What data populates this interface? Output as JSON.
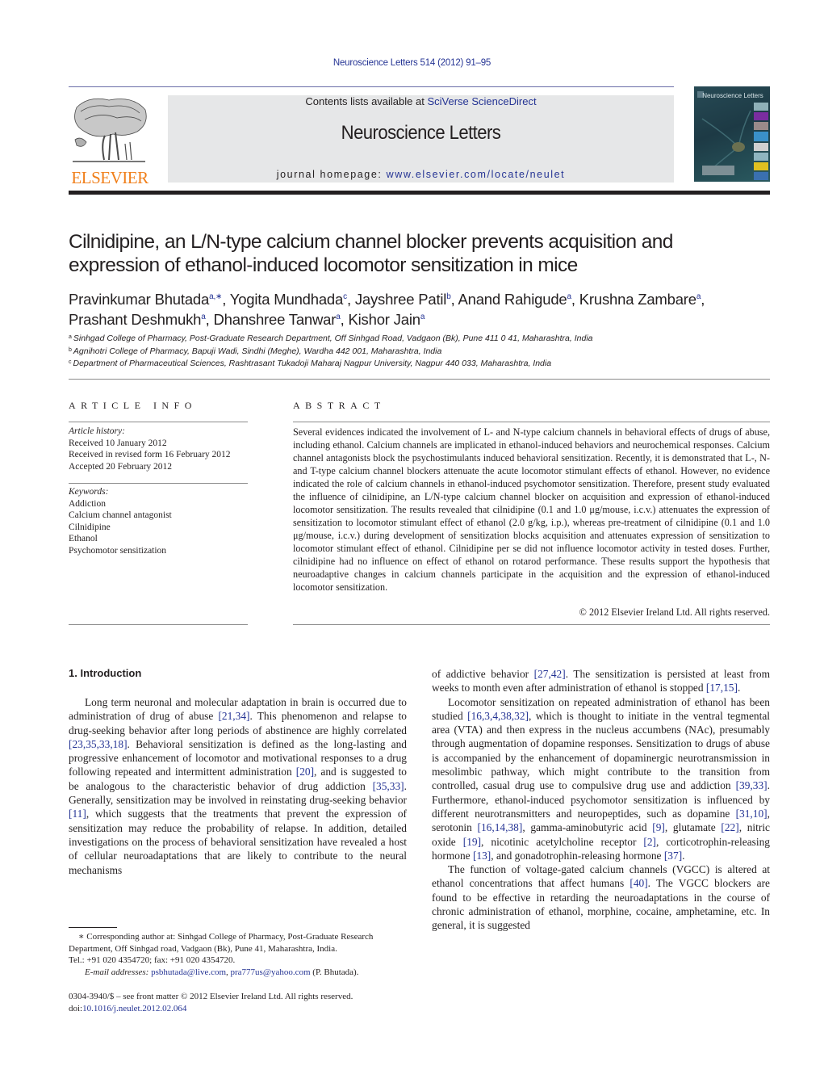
{
  "header": {
    "journal_ref": "Neuroscience Letters 514 (2012) 91–95",
    "contents_prefix": "Contents lists available at ",
    "contents_link": "SciVerse ScienceDirect",
    "journal_title": "Neuroscience Letters",
    "homepage_prefix": "journal homepage: ",
    "homepage_link": "www.elsevier.com/locate/neulet",
    "publisher_logo_text": "ELSEVIER",
    "cover_title": "Neuroscience Letters",
    "colors": {
      "link": "#253494",
      "elsevier_orange": "#f07f1a",
      "banner_bg": "#e6e7e8"
    }
  },
  "article": {
    "title": "Cilnidipine, an L/N-type calcium channel blocker prevents acquisition and expression of ethanol-induced locomotor sensitization in mice",
    "authors": [
      {
        "name": "Pravinkumar Bhutada",
        "sup": "a,∗"
      },
      {
        "name": "Yogita Mundhada",
        "sup": "c"
      },
      {
        "name": "Jayshree Patil",
        "sup": "b"
      },
      {
        "name": "Anand Rahigude",
        "sup": "a"
      },
      {
        "name": "Krushna Zambare",
        "sup": "a"
      },
      {
        "name": "Prashant Deshmukh",
        "sup": "a"
      },
      {
        "name": "Dhanshree Tanwar",
        "sup": "a"
      },
      {
        "name": "Kishor Jain",
        "sup": "a"
      }
    ],
    "affiliations": [
      {
        "key": "a",
        "text": "Sinhgad College of Pharmacy, Post-Graduate Research Department, Off Sinhgad Road, Vadgaon (Bk), Pune 411 0 41, Maharashtra, India"
      },
      {
        "key": "b",
        "text": "Agnihotri College of Pharmacy, Bapuji Wadi, Sindhi (Meghe), Wardha 442 001, Maharashtra, India"
      },
      {
        "key": "c",
        "text": "Department of Pharmaceutical Sciences, Rashtrasant Tukadoji Maharaj Nagpur University, Nagpur 440 033, Maharashtra, India"
      }
    ]
  },
  "article_info": {
    "heading": "ARTICLE INFO",
    "history_label": "Article history:",
    "history": [
      "Received 10 January 2012",
      "Received in revised form 16 February 2012",
      "Accepted 20 February 2012"
    ],
    "keywords_label": "Keywords:",
    "keywords": [
      "Addiction",
      "Calcium channel antagonist",
      "Cilnidipine",
      "Ethanol",
      "Psychomotor sensitization"
    ]
  },
  "abstract": {
    "heading": "ABSTRACT",
    "text": "Several evidences indicated the involvement of L- and N-type calcium channels in behavioral effects of drugs of abuse, including ethanol. Calcium channels are implicated in ethanol-induced behaviors and neurochemical responses. Calcium channel antagonists block the psychostimulants induced behavioral sensitization. Recently, it is demonstrated that L-, N- and T-type calcium channel blockers attenuate the acute locomotor stimulant effects of ethanol. However, no evidence indicated the role of calcium channels in ethanol-induced psychomotor sensitization. Therefore, present study evaluated the influence of cilnidipine, an L/N-type calcium channel blocker on acquisition and expression of ethanol-induced locomotor sensitization. The results revealed that cilnidipine (0.1 and 1.0 μg/mouse, i.c.v.) attenuates the expression of sensitization to locomotor stimulant effect of ethanol (2.0 g/kg, i.p.), whereas pre-treatment of cilnidipine (0.1 and 1.0 μg/mouse, i.c.v.) during development of sensitization blocks acquisition and attenuates expression of sensitization to locomotor stimulant effect of ethanol. Cilnidipine per se did not influence locomotor activity in tested doses. Further, cilnidipine had no influence on effect of ethanol on rotarod performance. These results support the hypothesis that neuroadaptive changes in calcium channels participate in the acquisition and the expression of ethanol-induced locomotor sensitization.",
    "copyright": "© 2012 Elsevier Ireland Ltd. All rights reserved."
  },
  "body": {
    "section_heading": "1.  Introduction",
    "left_paragraph": [
      {
        "t": "Long term neuronal and molecular adaptation in brain is occurred due to administration of drug of abuse "
      },
      {
        "ref": "[21,34]"
      },
      {
        "t": ". This phenomenon and relapse to drug-seeking behavior after long periods of abstinence are highly correlated "
      },
      {
        "ref": "[23,35,33,18]"
      },
      {
        "t": ". Behavioral sensitization is defined as the long-lasting and progressive enhancement of locomotor and motivational responses to a drug following repeated and intermittent administration "
      },
      {
        "ref": "[20]"
      },
      {
        "t": ", and is suggested to be analogous to the characteristic behavior of drug addiction "
      },
      {
        "ref": "[35,33]"
      },
      {
        "t": ". Generally, sensitization may be involved in reinstating drug-seeking behavior "
      },
      {
        "ref": "[11]"
      },
      {
        "t": ", which suggests that the treatments that prevent the expression of sensitization may reduce the probability of relapse. In addition, detailed investigations on the process of behavioral sensitization have revealed a host of cellular neuroadaptations that are likely to contribute to the neural mechanisms"
      }
    ],
    "right_paragraphs": [
      [
        {
          "t": "of addictive behavior "
        },
        {
          "ref": "[27,42]"
        },
        {
          "t": ". The sensitization is persisted at least from weeks to month even after administration of ethanol is stopped "
        },
        {
          "ref": "[17,15]"
        },
        {
          "t": "."
        }
      ],
      [
        {
          "t": "Locomotor sensitization on repeated administration of ethanol has been studied "
        },
        {
          "ref": "[16,3,4,38,32]"
        },
        {
          "t": ", which is thought to initiate in the ventral tegmental area (VTA) and then express in the nucleus accumbens (NAc), presumably through augmentation of dopamine responses. Sensitization to drugs of abuse is accompanied by the enhancement of dopaminergic neurotransmission in mesolimbic pathway, which might contribute to the transition from controlled, casual drug use to compulsive drug use and addiction "
        },
        {
          "ref": "[39,33]"
        },
        {
          "t": ". Furthermore, ethanol-induced psychomotor sensitization is influenced by different neurotransmitters and neuropeptides, such as dopamine "
        },
        {
          "ref": "[31,10]"
        },
        {
          "t": ", serotonin "
        },
        {
          "ref": "[16,14,38]"
        },
        {
          "t": ", gamma-aminobutyric acid "
        },
        {
          "ref": "[9]"
        },
        {
          "t": ", glutamate "
        },
        {
          "ref": "[22]"
        },
        {
          "t": ", nitric oxide "
        },
        {
          "ref": "[19]"
        },
        {
          "t": ", nicotinic acetylcholine receptor "
        },
        {
          "ref": "[2]"
        },
        {
          "t": ", corticotrophin-releasing hormone "
        },
        {
          "ref": "[13]"
        },
        {
          "t": ", and gonadotrophin-releasing hormone "
        },
        {
          "ref": "[37]"
        },
        {
          "t": "."
        }
      ],
      [
        {
          "t": "The function of voltage-gated calcium channels (VGCC) is altered at ethanol concentrations that affect humans "
        },
        {
          "ref": "[40]"
        },
        {
          "t": ". The VGCC blockers are found to be effective in retarding the neuroadaptations in the course of chronic administration of ethanol, morphine, cocaine, amphetamine, etc. In general, it is suggested"
        }
      ]
    ]
  },
  "footnote": {
    "corresponding": "∗  Corresponding author at: Sinhgad College of Pharmacy, Post-Graduate Research Department, Off Sinhgad road, Vadgaon (Bk), Pune 41, Maharashtra, India.",
    "tel": "Tel.: +91 020 4354720; fax: +91 020 4354720.",
    "email_label": "E-mail addresses:",
    "emails": [
      "psbhutada@live.com",
      "pra777us@yahoo.com"
    ],
    "email_suffix": "(P. Bhutada).",
    "front_matter": "0304-3940/$ – see front matter © 2012 Elsevier Ireland Ltd. All rights reserved.",
    "doi_prefix": "doi:",
    "doi": "10.1016/j.neulet.2012.02.064"
  }
}
